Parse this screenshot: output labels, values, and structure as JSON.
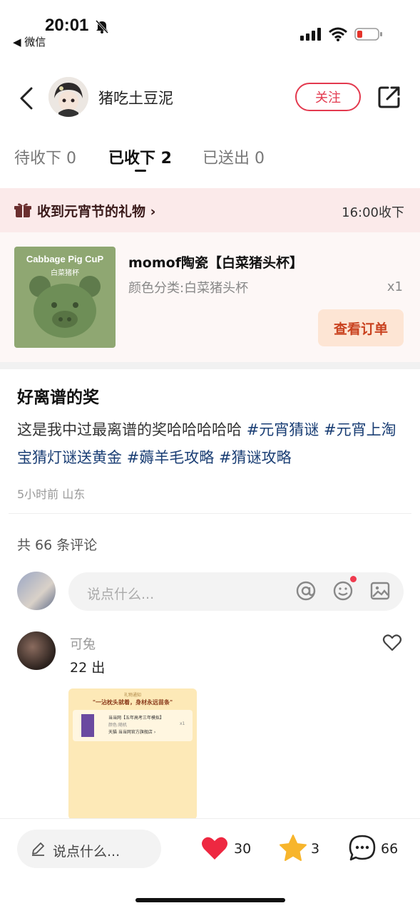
{
  "status_bar": {
    "time": "20:01",
    "back_app": "◀ 微信"
  },
  "header": {
    "username": "猪吃土豆泥",
    "follow_label": "关注"
  },
  "tabs": [
    {
      "label": "待收下 0"
    },
    {
      "label": "已收下 2"
    },
    {
      "label": "已送出 0"
    }
  ],
  "gift": {
    "text": "收到元宵节的礼物 ›",
    "time": "16:00收下"
  },
  "product": {
    "image_title": "Cabbage Pig CuP",
    "image_subtitle": "白菜猪杯",
    "title": "momof陶瓷【白菜猪头杯】",
    "variant": "颜色分类:白菜猪头杯",
    "qty": "x1",
    "order_button": "查看订单"
  },
  "post": {
    "title": "好离谱的奖",
    "body_text": "这是我中过最离谱的奖哈哈哈哈哈 ",
    "hashtags": [
      "#元宵猜谜",
      "#元宵上淘宝猜灯谜送黄金",
      "#薅羊毛攻略",
      "#猜谜攻略"
    ],
    "meta": "5小时前 山东"
  },
  "comments_header": "共 66 条评论",
  "comment_input": {
    "placeholder": "说点什么..."
  },
  "comment": {
    "name": "可兔",
    "text": "22 出",
    "image": {
      "top_label": "礼物通知",
      "headline": "\"一沾枕头就着，身材永远苗条\"",
      "item_title": "当当网【五年高考三年模拟】",
      "item_variant": "颜色:随机",
      "shop": "天猫 当当网官方旗舰店 ›",
      "qty": "x1"
    }
  },
  "bottom_bar": {
    "input_label": "说点什么...",
    "likes": "30",
    "stars": "3",
    "comments": "66"
  },
  "colors": {
    "accent": "#e3394e",
    "hashtag": "#1a3e74",
    "order_text": "#c9421f"
  }
}
